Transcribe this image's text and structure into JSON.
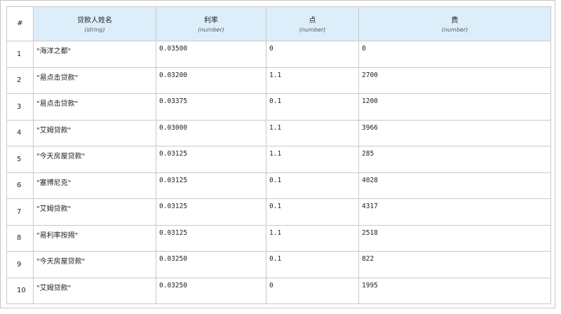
{
  "table": {
    "index_header": "#",
    "columns": [
      {
        "name": "贷款人姓名",
        "type": "(string)"
      },
      {
        "name": "利率",
        "type": "(number)"
      },
      {
        "name": "点",
        "type": "(number)"
      },
      {
        "name": "费",
        "type": "(number)"
      }
    ],
    "rows": [
      {
        "index": "1",
        "lender": "\"海洋之都\"",
        "rate": "0.03500",
        "points": "0",
        "fee": "0"
      },
      {
        "index": "2",
        "lender": "\"易点击贷款\"",
        "rate": "0.03200",
        "points": "1.1",
        "fee": "2700"
      },
      {
        "index": "3",
        "lender": "\"易点击贷款\"",
        "rate": "0.03375",
        "points": "0.1",
        "fee": "1200"
      },
      {
        "index": "4",
        "lender": "\"艾姆贷款\"",
        "rate": "0.03000",
        "points": "1.1",
        "fee": "3966"
      },
      {
        "index": "5",
        "lender": "\"今天房屋贷款\"",
        "rate": "0.03125",
        "points": "1.1",
        "fee": "285"
      },
      {
        "index": "6",
        "lender": "\"塞博尼克\"",
        "rate": "0.03125",
        "points": "0.1",
        "fee": "4028"
      },
      {
        "index": "7",
        "lender": "\"艾姆贷款\"",
        "rate": "0.03125",
        "points": "0.1",
        "fee": "4317"
      },
      {
        "index": "8",
        "lender": "\"易利率按揭\"",
        "rate": "0.03125",
        "points": "1.1",
        "fee": "2518"
      },
      {
        "index": "9",
        "lender": "\"今天房屋贷款\"",
        "rate": "0.03250",
        "points": "0.1",
        "fee": "822"
      },
      {
        "index": "10",
        "lender": "\"艾姆贷款\"",
        "rate": "0.03250",
        "points": "0",
        "fee": "1995"
      }
    ]
  }
}
